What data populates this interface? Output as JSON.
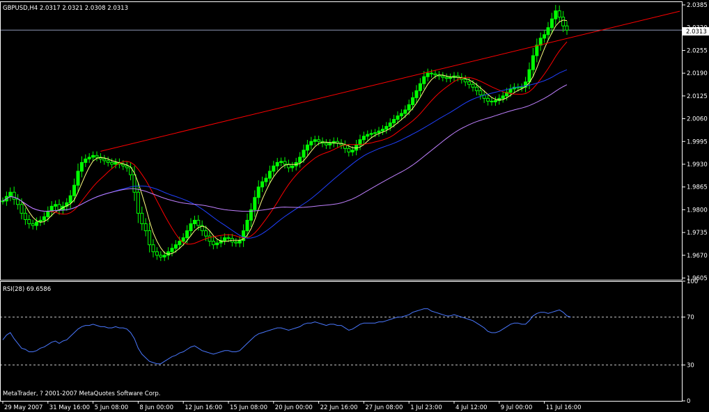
{
  "window": {
    "header": "GBPUSD,H4  2.0317 2.0321 2.0308 2.0313",
    "current_price_label": "2.0313",
    "copyright": "MetaTrader, ? 2001-2007 MetaQuotes Software Corp.",
    "rsi_header": "RSI(28) 69.6586"
  },
  "colors": {
    "background": "#000000",
    "axis": "#ffffff",
    "candle": "#00ff00",
    "ma_fast": "#ffff80",
    "ma_mid": "#ff0000",
    "ma_slow": "#2040ff",
    "ma_slowest": "#c080ff",
    "trendline": "#ff0000",
    "rsi": "#4a78ff",
    "price_line": "#9098b8"
  },
  "chart_data": {
    "type": "candlestick",
    "symbol": "GBPUSD",
    "timeframe": "H4",
    "ohlc_last": {
      "open": 2.0317,
      "high": 2.0321,
      "low": 2.0308,
      "close": 2.0313
    },
    "current_price": 2.0313,
    "price_axis": {
      "ticks": [
        "2.0385",
        "2.0320",
        "2.0255",
        "2.0190",
        "2.0125",
        "2.0060",
        "1.9995",
        "1.9930",
        "1.9865",
        "1.9800",
        "1.9735",
        "1.9670",
        "1.9605"
      ],
      "ylim": [
        1.96,
        2.0395
      ]
    },
    "time_axis": {
      "ticks": [
        "29 May 2007",
        "31 May 16:00",
        "5 Jun 08:00",
        "8 Jun 00:00",
        "12 Jun 16:00",
        "15 Jun 08:00",
        "20 Jun 00:00",
        "22 Jun 16:00",
        "27 Jun 08:00",
        "1 Jul 23:00",
        "4 Jul 12:00",
        "9 Jul 00:00",
        "11 Jul 16:00"
      ],
      "tick_index": [
        0,
        12,
        24,
        36,
        48,
        60,
        72,
        84,
        96,
        108,
        120,
        132,
        144
      ],
      "xlim": [
        0,
        180
      ]
    },
    "trendline": {
      "from": [
        26,
        1.9967
      ],
      "to": [
        180,
        2.0367
      ]
    },
    "close": [
      1.9825,
      1.9838,
      1.985,
      1.983,
      1.9815,
      1.979,
      1.9772,
      1.976,
      1.9755,
      1.9765,
      1.977,
      1.978,
      1.9795,
      1.981,
      1.9815,
      1.98,
      1.981,
      1.982,
      1.984,
      1.987,
      1.991,
      1.9935,
      1.9945,
      1.995,
      1.9955,
      1.995,
      1.9945,
      1.994,
      1.9935,
      1.993,
      1.9935,
      1.993,
      1.9925,
      1.992,
      1.99,
      1.985,
      1.979,
      1.976,
      1.974,
      1.97,
      1.968,
      1.967,
      1.9665,
      1.967,
      1.968,
      1.969,
      1.97,
      1.971,
      1.972,
      1.974,
      1.976,
      1.977,
      1.9755,
      1.974,
      1.9725,
      1.971,
      1.97,
      1.9705,
      1.9712,
      1.972,
      1.9718,
      1.9708,
      1.9705,
      1.9712,
      1.974,
      1.977,
      1.98,
      1.9835,
      1.9865,
      1.988,
      1.989,
      1.991,
      1.9925,
      1.9935,
      1.9938,
      1.993,
      1.992,
      1.9925,
      1.9935,
      1.995,
      1.997,
      1.9985,
      1.9995,
      2.0,
      1.9995,
      1.999,
      1.9985,
      1.999,
      1.9995,
      1.999,
      1.9985,
      1.9975,
      1.9965,
      1.997,
      1.9985,
      2.0,
      2.001,
      2.0015,
      2.0018,
      2.002,
      2.0025,
      2.003,
      2.0038,
      2.0048,
      2.0058,
      2.0068,
      2.0075,
      2.0085,
      2.01,
      2.012,
      2.014,
      2.016,
      2.018,
      2.019,
      2.0188,
      2.0185,
      2.0182,
      2.0178,
      2.0175,
      2.0178,
      2.0182,
      2.0178,
      2.0172,
      2.0165,
      2.0158,
      2.015,
      2.014,
      2.0128,
      2.0118,
      2.011,
      2.0108,
      2.0112,
      2.0118,
      2.0125,
      2.0135,
      2.0145,
      2.015,
      2.0148,
      2.015,
      2.0165,
      2.02,
      2.024,
      2.027,
      2.029,
      2.03,
      2.032,
      2.0345,
      2.0368,
      2.035,
      2.0325,
      2.0313
    ],
    "rsi": {
      "period": 28,
      "last": 69.6586,
      "ylim": [
        0,
        100
      ],
      "levels": [
        30,
        70
      ],
      "ticks": [
        "100",
        "70",
        "30",
        "0"
      ],
      "values": [
        51,
        55,
        57,
        52,
        48,
        44,
        43,
        41,
        41,
        42,
        44,
        45,
        47,
        49,
        50,
        48,
        50,
        51,
        54,
        57,
        60,
        62,
        63,
        63,
        64,
        63,
        62,
        62,
        61,
        61,
        62,
        61,
        61,
        60,
        57,
        52,
        44,
        39,
        36,
        33,
        32,
        31,
        31,
        33,
        35,
        37,
        38,
        40,
        41,
        43,
        45,
        46,
        44,
        42,
        41,
        40,
        39,
        40,
        41,
        42,
        42,
        41,
        41,
        42,
        45,
        48,
        51,
        54,
        56,
        57,
        58,
        59,
        60,
        61,
        61,
        60,
        59,
        60,
        61,
        62,
        64,
        65,
        65,
        66,
        65,
        64,
        63,
        64,
        64,
        63,
        63,
        61,
        59,
        60,
        62,
        64,
        65,
        65,
        65,
        65,
        66,
        66,
        67,
        68,
        69,
        70,
        70,
        71,
        72,
        74,
        75,
        76,
        77,
        77,
        75,
        74,
        73,
        72,
        71,
        71,
        72,
        71,
        70,
        69,
        68,
        67,
        65,
        63,
        61,
        58,
        57,
        57,
        58,
        60,
        62,
        64,
        65,
        65,
        64,
        64,
        67,
        71,
        73,
        74,
        74,
        73,
        74,
        75,
        76,
        74,
        71,
        70
      ]
    },
    "moving_averages": [
      "ma_fast",
      "ma_mid",
      "ma_slow",
      "ma_slowest"
    ]
  }
}
